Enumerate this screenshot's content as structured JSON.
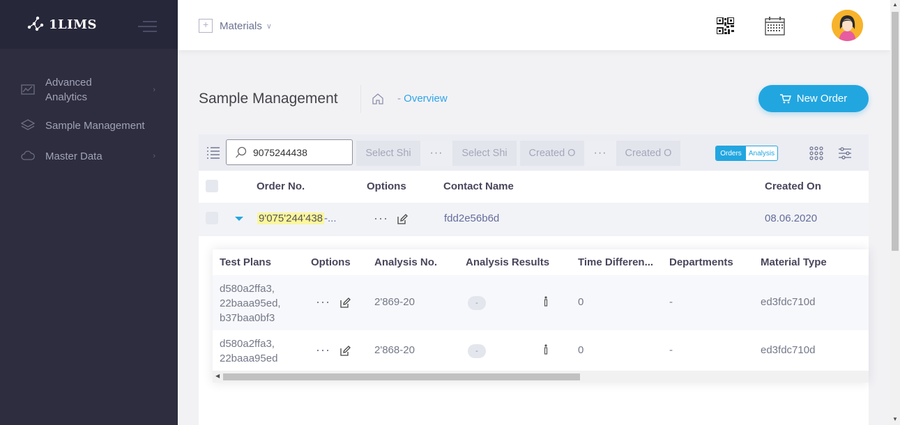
{
  "brand": {
    "name": "1LIMS"
  },
  "sidebar": {
    "items": [
      {
        "label": "Advanced Analytics",
        "icon": "chart-icon",
        "has_submenu": true
      },
      {
        "label": "Sample Management",
        "icon": "layers-icon",
        "has_submenu": false
      },
      {
        "label": "Master Data",
        "icon": "cloud-icon",
        "has_submenu": true
      }
    ]
  },
  "topbar": {
    "module": "Materials"
  },
  "page": {
    "title": "Sample Management",
    "breadcrumb_sep": "-",
    "breadcrumb_current": "Overview",
    "new_order_label": "New Order"
  },
  "toolbar": {
    "search_value": "9075244438",
    "filter1_from": "Select Shi",
    "filter1_to": "Select Shi",
    "filter2_from": "Created O",
    "filter2_to": "Created O",
    "ellipsis": "···",
    "toggle_orders": "Orders",
    "toggle_analysis": "Analysis"
  },
  "table": {
    "columns": {
      "order_no": "Order No.",
      "options": "Options",
      "contact_name": "Contact Name",
      "created_on": "Created On"
    },
    "rows": [
      {
        "order_no": "9'075'244'438",
        "order_no_suffix": "-...",
        "contact_name": "fdd2e56b6d",
        "created_on": "08.06.2020"
      }
    ]
  },
  "nested": {
    "columns": {
      "test_plans": "Test Plans",
      "options": "Options",
      "analysis_no": "Analysis No.",
      "analysis_results": "Analysis Results",
      "time_difference": "Time Differen...",
      "departments": "Departments",
      "material_type": "Material Type"
    },
    "rows": [
      {
        "test_plans": [
          "d580a2ffa3,",
          "22baaa95ed,",
          "b37baa0bf3"
        ],
        "analysis_no": "2'869-20",
        "result": "-",
        "time_difference": "0",
        "departments": "-",
        "material_type": "ed3fdc710d"
      },
      {
        "test_plans": [
          "d580a2ffa3,",
          "22baaa95ed"
        ],
        "analysis_no": "2'868-20",
        "result": "-",
        "time_difference": "0",
        "departments": "-",
        "material_type": "ed3fdc710d"
      }
    ]
  },
  "colors": {
    "accent": "#22a6e0",
    "sidebar_bg": "#2d2d3f",
    "highlight": "#fbf69d"
  }
}
